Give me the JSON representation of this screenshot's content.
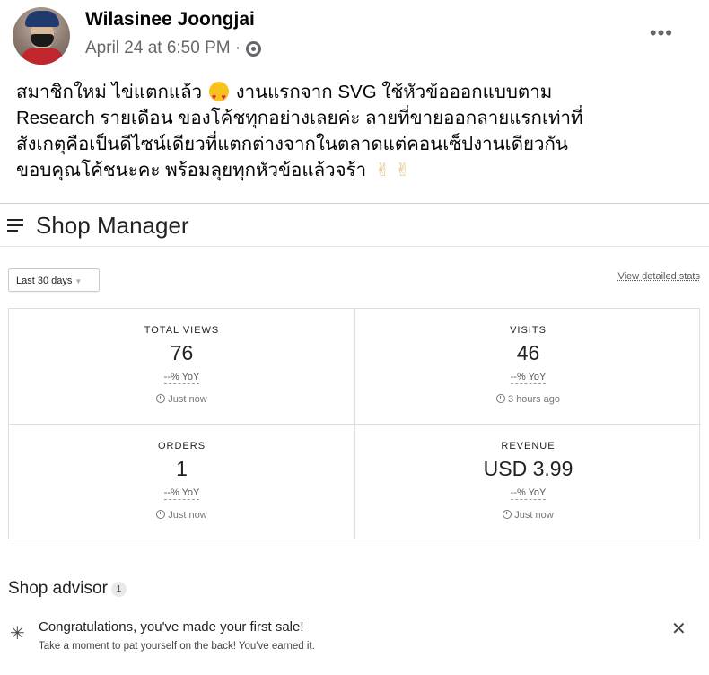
{
  "post": {
    "author": "Wilasinee Joongjai",
    "timestamp": "April 24 at 6:50 PM ·",
    "more_label": "•••",
    "lines": [
      {
        "pre": "สมาชิกใหม่ ไข่แตกแล้ว",
        "post": "งานแรกจาก SVG ใช้หัวข้อออกแบบตาม"
      },
      {
        "text": "Research รายเดือน ของโค้ชทุกอย่างเลยค่ะ ลายที่ขายออกลายแรกเท่าที่"
      },
      {
        "text": "สังเกตุคือเป็นดีไซน์เดียวที่แตกต่างจากในตลาดแต่คอนเซ็ปงานเดียวกัน"
      },
      {
        "text": "ขอบคุณโค้ชนะคะ  พร้อมลุยทุกหัวข้อแล้วจร้า",
        "trail": "✌ ✌"
      }
    ]
  },
  "shop_manager": {
    "title": "Shop Manager",
    "date_range": "Last 30 days",
    "caret": "▼",
    "view_stats": "View detailed stats",
    "stats": [
      {
        "label": "TOTAL VIEWS",
        "value": "76",
        "yoy": "--% YoY",
        "time": "Just now"
      },
      {
        "label": "VISITS",
        "value": "46",
        "yoy": "--% YoY",
        "time": "3 hours ago"
      },
      {
        "label": "ORDERS",
        "value": "1",
        "yoy": "--% YoY",
        "time": "Just now"
      },
      {
        "label": "REVENUE",
        "value": "USD 3.99",
        "yoy": "--% YoY",
        "time": "Just now"
      }
    ],
    "advisor": {
      "title": "Shop advisor",
      "count": "1",
      "message": "Congratulations, you've made your first sale!",
      "sub": "Take a moment to pat yourself on the back! You've earned it.",
      "close": "✕"
    }
  },
  "icons": {
    "burst": "✳",
    "emoji": "heart-eyes-emoji",
    "victory": "victory-hand-emoji"
  }
}
